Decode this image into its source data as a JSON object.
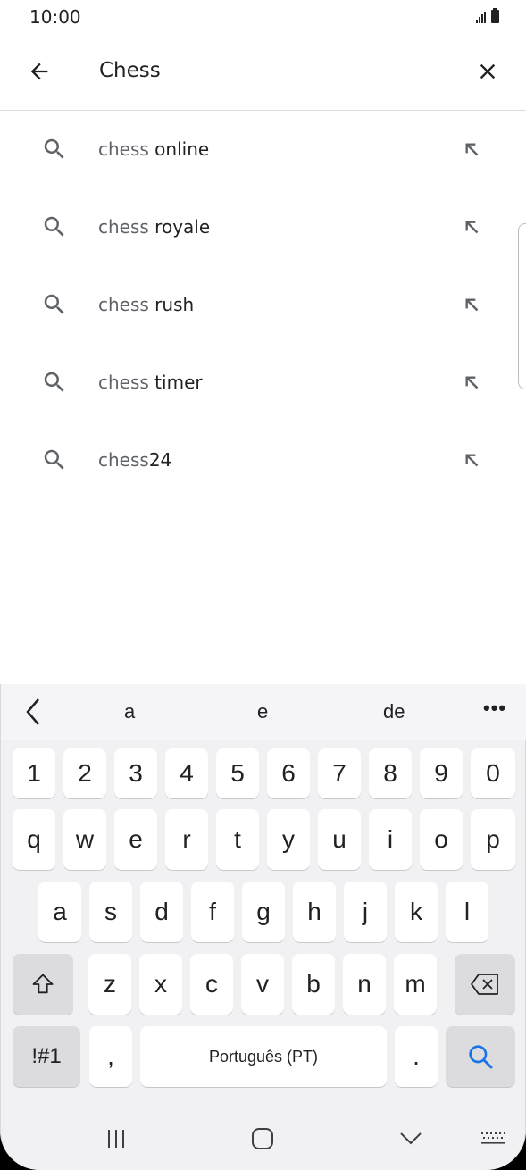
{
  "status": {
    "time": "10:00",
    "icons": [
      "signal-icon",
      "battery-icon"
    ]
  },
  "search": {
    "query": "Chess",
    "back_icon": "arrow-left-icon",
    "clear_icon": "close-icon"
  },
  "suggestions": [
    {
      "prefix": "chess",
      "suffix": " online"
    },
    {
      "prefix": "chess",
      "suffix": " royale"
    },
    {
      "prefix": "chess",
      "suffix": " rush"
    },
    {
      "prefix": "chess",
      "suffix": " timer"
    },
    {
      "prefix": "chess",
      "suffix": "24"
    }
  ],
  "keyboard": {
    "suggestions": [
      "a",
      "e",
      "de"
    ],
    "more": "•••",
    "row_numbers": [
      "1",
      "2",
      "3",
      "4",
      "5",
      "6",
      "7",
      "8",
      "9",
      "0"
    ],
    "row1": [
      "q",
      "w",
      "e",
      "r",
      "t",
      "y",
      "u",
      "i",
      "o",
      "p"
    ],
    "row2": [
      "a",
      "s",
      "d",
      "f",
      "g",
      "h",
      "j",
      "k",
      "l"
    ],
    "row3": [
      "z",
      "x",
      "c",
      "v",
      "b",
      "n",
      "m"
    ],
    "symbols_key": "!#1",
    "comma_key": ",",
    "space_label": "Português (PT)",
    "period_key": "."
  },
  "colors": {
    "accent": "#1a73e8",
    "keyboard_bg": "#f1f1f3"
  }
}
